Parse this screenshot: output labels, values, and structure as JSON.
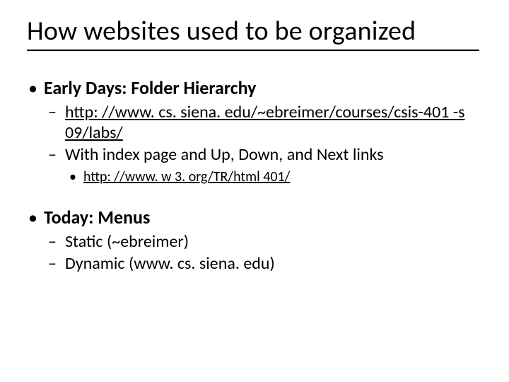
{
  "title": "How websites used to be organized",
  "sections": [
    {
      "heading": "Early Days: Folder Hierarchy",
      "items": [
        {
          "type": "link",
          "text": "http: //www. cs. siena. edu/~ebreimer/courses/csis-401 -s 09/labs/"
        },
        {
          "type": "text",
          "text": "With index page and Up, Down, and Next links",
          "subitems": [
            {
              "type": "link",
              "text": "http: //www. w 3. org/TR/html 401/"
            }
          ]
        }
      ]
    },
    {
      "heading": "Today: Menus",
      "items": [
        {
          "type": "text",
          "text": "Static (~ebreimer)"
        },
        {
          "type": "text",
          "text": "Dynamic (www. cs. siena. edu)"
        }
      ]
    }
  ]
}
